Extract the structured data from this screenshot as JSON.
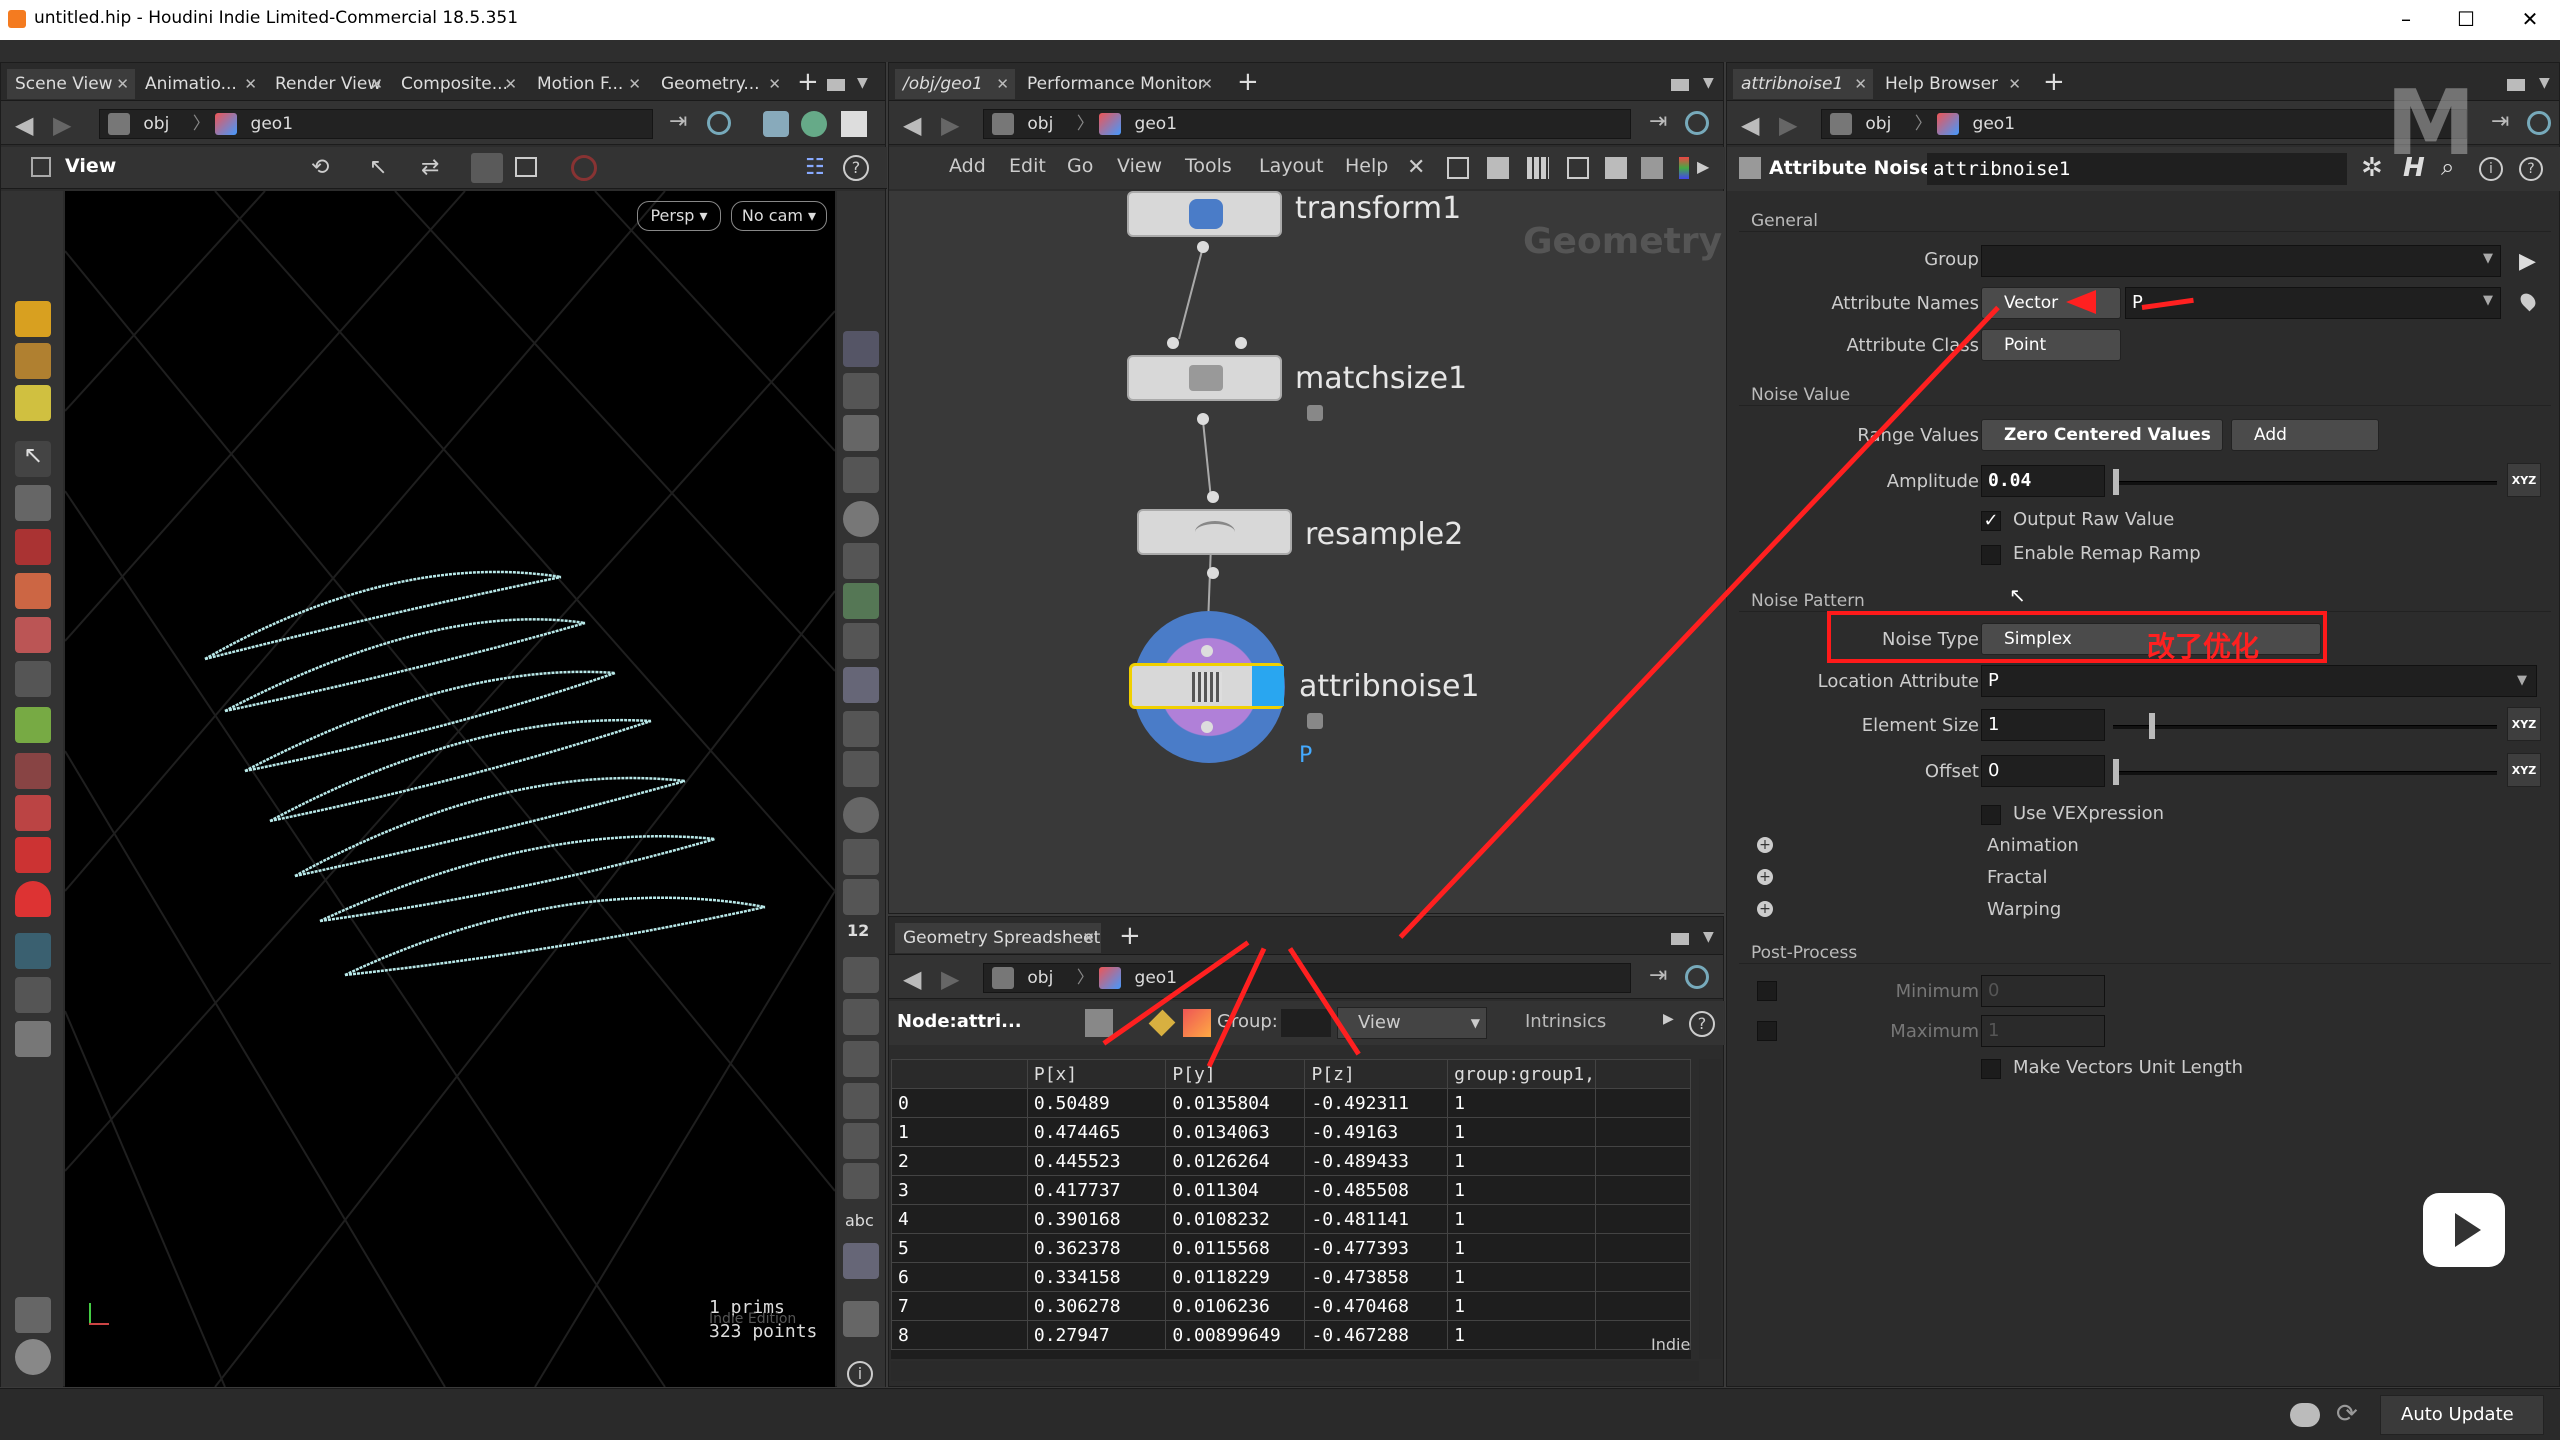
{
  "window": {
    "title": "untitled.hip - Houdini Indie Limited-Commercial 18.5.351",
    "minimize": "–",
    "maximize": "☐",
    "close": "✕"
  },
  "left_pane": {
    "tabs": [
      "Scene View",
      "Animatio...",
      "Render View",
      "Composite...",
      "Motion F...",
      "Geometry..."
    ],
    "path": {
      "root": "obj",
      "node": "geo1"
    },
    "toolbar_label": "View",
    "persp_btn": "Persp ▾",
    "cam_btn": "No cam ▾",
    "info": {
      "prims": "1   prims",
      "points": "323 points"
    },
    "watermark": "Indie Edition"
  },
  "network_pane": {
    "tabs": [
      "/obj/geo1",
      "Performance Monitor"
    ],
    "path": {
      "root": "obj",
      "node": "geo1"
    },
    "menu": [
      "Add",
      "Edit",
      "Go",
      "View",
      "Tools",
      "Layout",
      "Help"
    ],
    "context_label": "Geometry",
    "nodes": [
      {
        "name": "transform1"
      },
      {
        "name": "matchsize1"
      },
      {
        "name": "resample2"
      },
      {
        "name": "attribnoise1",
        "flag": "P"
      }
    ]
  },
  "spreadsheet": {
    "tab": "Geometry Spreadsheet",
    "path": {
      "root": "obj",
      "node": "geo1"
    },
    "node_label": "Node:attri...",
    "group_label": "Group:",
    "view_label": "View",
    "intrinsics_label": "Intrinsics",
    "columns": [
      "",
      "P[x]",
      "P[y]",
      "P[z]",
      "group:group1,"
    ],
    "rows": [
      [
        "0",
        "0.50489",
        "0.0135804",
        "-0.492311",
        "1"
      ],
      [
        "1",
        "0.474465",
        "0.0134063",
        "-0.49163",
        "1"
      ],
      [
        "2",
        "0.445523",
        "0.0126264",
        "-0.489433",
        "1"
      ],
      [
        "3",
        "0.417737",
        "0.011304",
        "-0.485508",
        "1"
      ],
      [
        "4",
        "0.390168",
        "0.0108232",
        "-0.481141",
        "1"
      ],
      [
        "5",
        "0.362378",
        "0.0115568",
        "-0.477393",
        "1"
      ],
      [
        "6",
        "0.334158",
        "0.0118229",
        "-0.473858",
        "1"
      ],
      [
        "7",
        "0.306278",
        "0.0106236",
        "-0.470468",
        "1"
      ],
      [
        "8",
        "0.27947",
        "0.00899649",
        "-0.467288",
        "1"
      ]
    ],
    "footer": "Indie"
  },
  "param_pane": {
    "tabs": [
      "attribnoise1",
      "Help Browser"
    ],
    "path": {
      "root": "obj",
      "node": "geo1"
    },
    "node_type": "Attribute Noise",
    "node_name": "attribnoise1",
    "general": {
      "title": "General",
      "group_label": "Group",
      "group_value": "",
      "attr_names_label": "Attribute Names",
      "attr_names_type": "Vector",
      "attr_names_value": "P",
      "attr_class_label": "Attribute Class",
      "attr_class_value": "Point"
    },
    "noise_value": {
      "title": "Noise Value",
      "range_label": "Range Values",
      "range_value": "Zero Centered Values",
      "op_value": "Add",
      "amplitude_label": "Amplitude",
      "amplitude_value": "0.04",
      "output_raw": "Output Raw Value",
      "enable_ramp": "Enable Remap Ramp"
    },
    "noise_pattern": {
      "title": "Noise Pattern",
      "type_label": "Noise Type",
      "type_value": "Simplex",
      "annotation": "改了优化",
      "loc_label": "Location Attribute",
      "loc_value": "P",
      "elem_label": "Element Size",
      "elem_value": "1",
      "offset_label": "Offset",
      "offset_value": "0",
      "use_vex": "Use VEXpression",
      "folders": [
        "Animation",
        "Fractal",
        "Warping"
      ]
    },
    "post": {
      "title": "Post-Process",
      "min_label": "Minimum",
      "min_value": "0",
      "max_label": "Maximum",
      "max_value": "1",
      "unit": "Make Vectors Unit Length"
    }
  },
  "statusbar": {
    "auto_update": "Auto Update"
  },
  "xyz": "XYZ"
}
